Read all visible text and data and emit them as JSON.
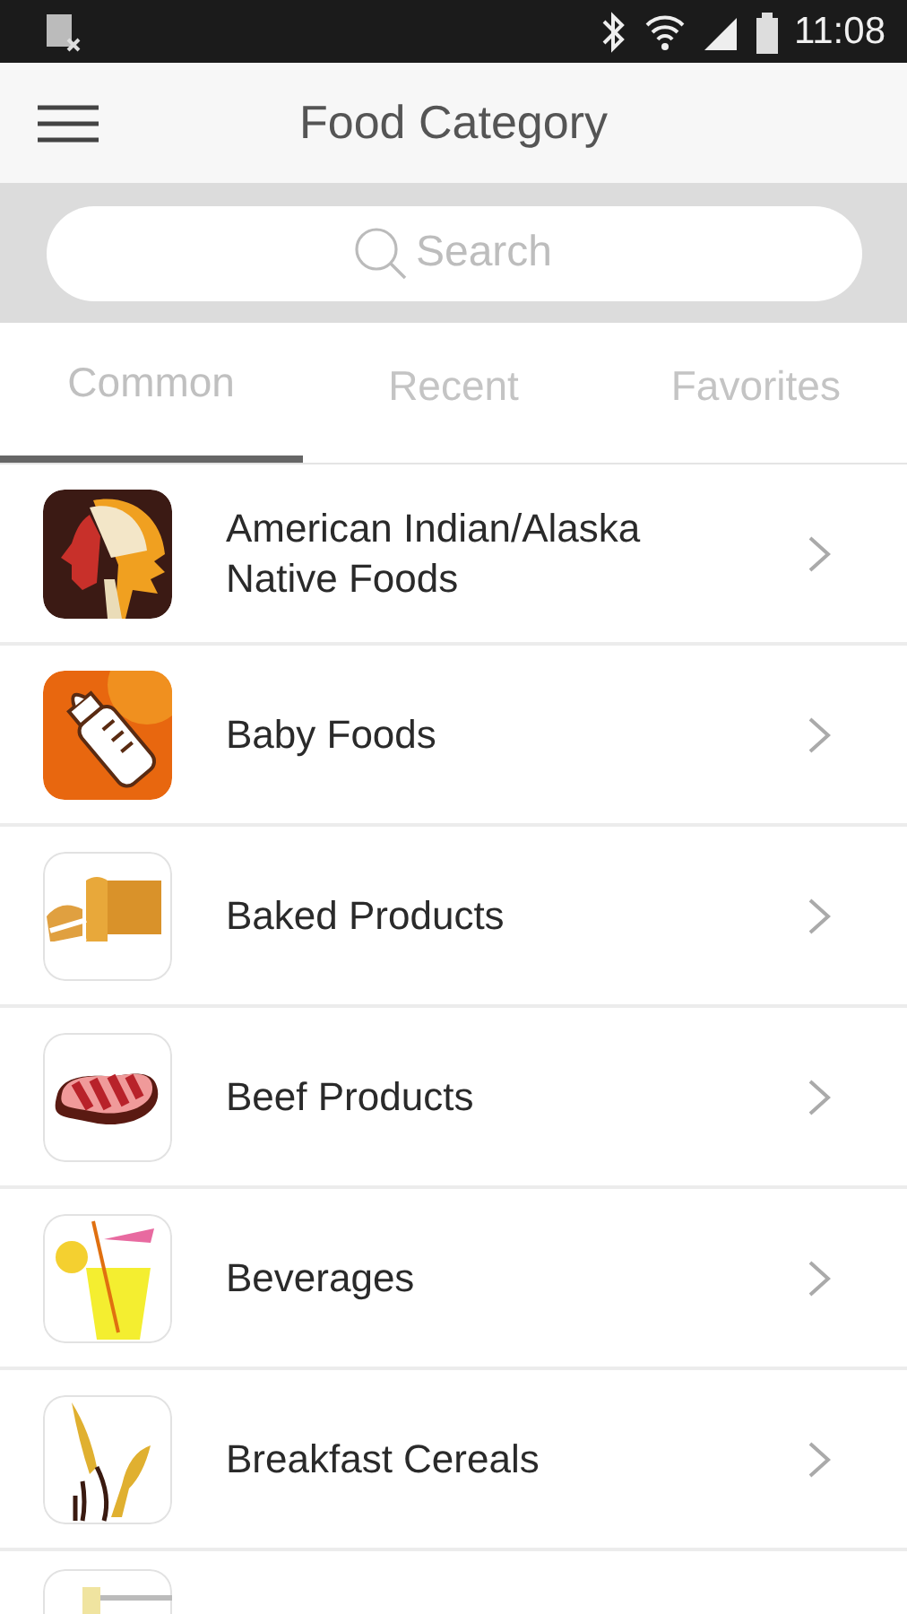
{
  "status_bar": {
    "time": "11:08"
  },
  "header": {
    "title": "Food Category"
  },
  "search": {
    "placeholder": "Search"
  },
  "tabs": [
    {
      "label": "Common",
      "selected": true
    },
    {
      "label": "Recent",
      "selected": false
    },
    {
      "label": "Favorites",
      "selected": false
    }
  ],
  "categories": [
    {
      "name": "American Indian/Alaska Native Foods"
    },
    {
      "name": "Baby Foods"
    },
    {
      "name": "Baked Products"
    },
    {
      "name": "Beef Products"
    },
    {
      "name": "Beverages"
    },
    {
      "name": "Breakfast Cereals"
    },
    {
      "kind": "cut-off"
    }
  ]
}
